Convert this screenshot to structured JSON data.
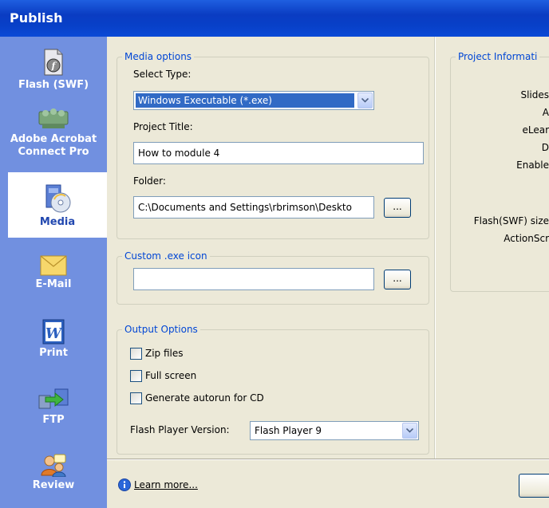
{
  "window": {
    "title": "Publish"
  },
  "sidebar": {
    "items": [
      {
        "label": "Flash (SWF)",
        "icon": "flash-icon"
      },
      {
        "label": "Adobe Acrobat Connect Pro",
        "label_line1": "Adobe Acrobat",
        "label_line2": "Connect Pro",
        "icon": "acrobat-connect-icon"
      },
      {
        "label": "Media",
        "icon": "media-cd-icon",
        "selected": true
      },
      {
        "label": "E-Mail",
        "icon": "envelope-icon"
      },
      {
        "label": "Print",
        "icon": "word-icon"
      },
      {
        "label": "FTP",
        "icon": "ftp-transfer-icon"
      },
      {
        "label": "Review",
        "icon": "review-people-icon"
      }
    ]
  },
  "media_options": {
    "legend": "Media options",
    "select_type_label": "Select Type:",
    "select_type_value": "Windows Executable (*.exe)",
    "project_title_label": "Project Title:",
    "project_title_value": "How to module 4",
    "folder_label": "Folder:",
    "folder_value": "C:\\Documents and Settings\\rbrimson\\Deskto",
    "browse_label": "..."
  },
  "custom_icon": {
    "legend": "Custom .exe icon",
    "value": "",
    "browse_label": "..."
  },
  "output_options": {
    "legend": "Output Options",
    "zip_files": {
      "label": "Zip files",
      "checked": false
    },
    "full_screen": {
      "label": "Full screen",
      "checked": false
    },
    "autorun": {
      "label": "Generate autorun for CD",
      "checked": false
    },
    "flash_player_label": "Flash Player Version:",
    "flash_player_value": "Flash Player 9"
  },
  "project_info": {
    "legend": "Project Informati",
    "rows": [
      "Slides",
      "A",
      "eLear",
      "D",
      "Enable",
      "Flash(SWF) size",
      "ActionScr"
    ]
  },
  "footer": {
    "learn_more": "Learn more..."
  },
  "colors": {
    "accent": "#0046d5",
    "sidebar": "#7190e0",
    "title_bar": "#0a3cc2"
  }
}
